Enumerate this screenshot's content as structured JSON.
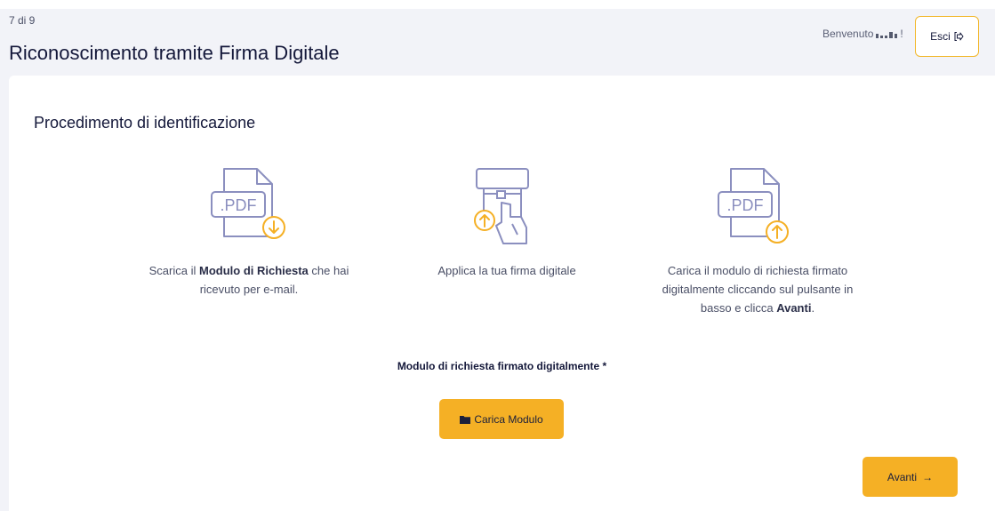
{
  "header": {
    "step": "7 di 9",
    "title": "Riconoscimento tramite Firma Digitale",
    "welcome": "Benvenuto",
    "welcome_suffix": "!",
    "exit_label": "Esci",
    "exit_icon": "exit-icon"
  },
  "main": {
    "section_title": "Procedimento di identificazione",
    "steps": [
      {
        "icon": "pdf-download-icon",
        "icon_text": ".PDF",
        "text_before": "Scarica il ",
        "text_bold": "Modulo di Richiesta",
        "text_after": " che hai ricevuto per e-mail."
      },
      {
        "icon": "sign-upload-icon",
        "text": "Applica la tua firma digitale"
      },
      {
        "icon": "pdf-upload-icon",
        "icon_text": ".PDF",
        "text_before": "Carica il modulo di richiesta firmato digitalmente cliccando sul pulsante in basso e clicca ",
        "text_bold": "Avanti",
        "text_after": "."
      }
    ],
    "field_label": "Modulo di richiesta firmato digitalmente *",
    "upload_button": "Carica Modulo",
    "upload_icon": "folder-icon",
    "next_button": "Avanti",
    "next_icon": "arrow-right-icon"
  },
  "colors": {
    "accent": "#f5b025",
    "icon_stroke": "#8b8fbf",
    "background": "#f2f3f8",
    "text": "#14183a"
  }
}
